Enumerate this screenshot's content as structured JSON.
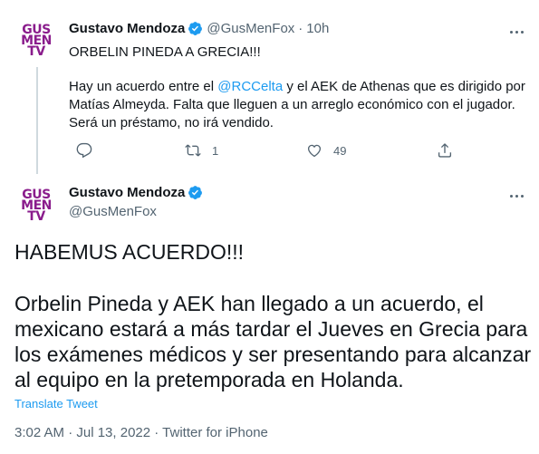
{
  "colors": {
    "accent": "#1d9bf0",
    "text": "#0f1419",
    "muted": "#536471",
    "logo": "#8a1c8c"
  },
  "tweet1": {
    "avatar_lines": [
      "GUS",
      "MEN",
      "TV"
    ],
    "name": "Gustavo Mendoza",
    "handle": "@GusMenFox",
    "separator": "·",
    "time": "10h",
    "headline": "ORBELIN PINEDA A GRECIA!!!",
    "body_line1_pre": "Hay un acuerdo entre el ",
    "body_line1_mention": "@RCCelta",
    "body_line1_post": " y el AEK de Athenas que es dirigido por",
    "body_line2": "Matías Almeyda. Falta que lleguen a un arreglo económico con el jugador.",
    "body_line3": "Será un préstamo, no irá vendido.",
    "actions": {
      "reply_icon": "reply-icon",
      "retweet_icon": "retweet-icon",
      "retweet_count": "1",
      "like_icon": "heart-icon",
      "like_count": "49",
      "share_icon": "share-icon"
    }
  },
  "tweet2": {
    "avatar_lines": [
      "GUS",
      "MEN",
      "TV"
    ],
    "name": "Gustavo Mendoza",
    "handle": "@GusMenFox",
    "headline": "HABEMUS ACUERDO!!!",
    "body_lines": [
      "Orbelin Pineda y AEK han llegado a un acuerdo, el",
      "mexicano estará a más tardar el Jueves en Grecia para",
      "los exámenes médicos y ser presentando para alcanzar",
      "al equipo en la pretemporada en Holanda."
    ],
    "translate": "Translate Tweet",
    "meta": "3:02 AM · Jul 13, 2022 · Twitter for iPhone"
  }
}
